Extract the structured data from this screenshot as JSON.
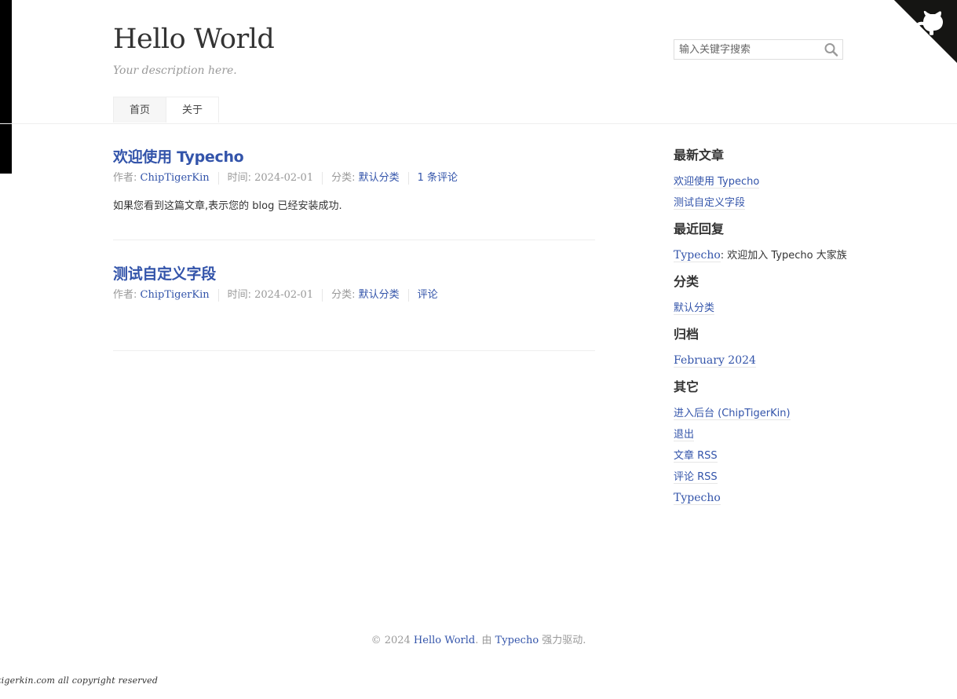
{
  "site": {
    "title": "Hello World",
    "description": "Your description here."
  },
  "search": {
    "placeholder": "输入关键字搜索"
  },
  "nav": {
    "items": [
      {
        "label": "首页"
      },
      {
        "label": "关于"
      }
    ]
  },
  "posts": [
    {
      "title": "欢迎使用 Typecho",
      "author_label": "作者: ",
      "author": "ChipTigerKin",
      "time_label": "时间: ",
      "time": "2024-02-01",
      "category_label": "分类: ",
      "category": "默认分类",
      "comments": "1 条评论",
      "excerpt": "如果您看到这篇文章,表示您的 blog 已经安装成功."
    },
    {
      "title": "测试自定义字段",
      "author_label": "作者: ",
      "author": "ChipTigerKin",
      "time_label": "时间: ",
      "time": "2024-02-01",
      "category_label": "分类: ",
      "category": "默认分类",
      "comments": "评论"
    }
  ],
  "sidebar": {
    "recent_posts": {
      "title": "最新文章",
      "items": [
        "欢迎使用 Typecho",
        "测试自定义字段"
      ]
    },
    "recent_comments": {
      "title": "最近回复",
      "items": [
        {
          "author": "Typecho",
          "text": ": 欢迎加入 Typecho 大家族"
        }
      ]
    },
    "categories": {
      "title": "分类",
      "items": [
        "默认分类"
      ]
    },
    "archives": {
      "title": "归档",
      "items": [
        "February 2024"
      ]
    },
    "other": {
      "title": "其它",
      "items": [
        "进入后台 (ChipTigerKin)",
        "退出",
        "文章 RSS",
        "评论 RSS",
        "Typecho"
      ]
    }
  },
  "footer": {
    "copyright": "© 2024 ",
    "site_link": "Hello World",
    "powered_prefix": ". 由 ",
    "powered_link": "Typecho",
    "powered_suffix": " 强力驱动."
  },
  "bottom_note": "tigerkin.com all copyright reserved",
  "icons": {
    "search": "search-icon",
    "corner": "github-cat-icon"
  },
  "colors": {
    "link": "#3354AA",
    "muted": "#999999",
    "text": "#444444"
  }
}
